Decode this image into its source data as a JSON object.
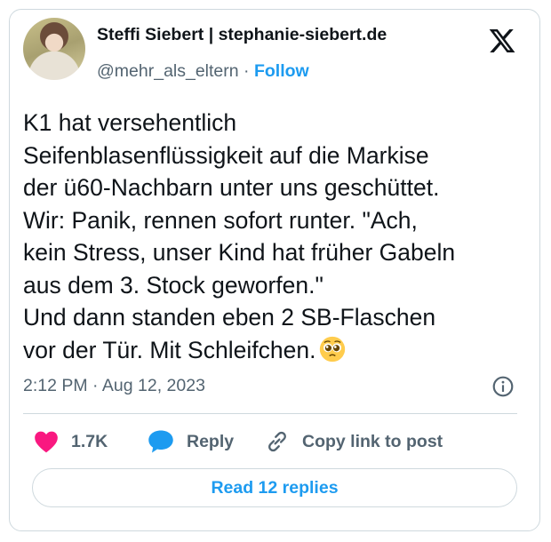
{
  "author": {
    "name": "Steffi Siebert | stephanie-siebert.de",
    "handle": "@mehr_als_eltern",
    "separator": "·",
    "follow_label": "Follow"
  },
  "tweet": {
    "text": "K1 hat versehentlich\nSeifenblasenflüssigkeit auf die Markise\nder ü60-Nachbarn unter uns geschüttet.\nWir: Panik, rennen sofort runter. \"Ach,\nkein Stress, unser Kind hat früher Gabeln\naus dem 3. Stock geworfen.\"\nUnd dann standen eben 2 SB-Flaschen\nvor der Tür. Mit Schleifchen.",
    "emoji": "pleading-face-emoji",
    "time": "2:12 PM",
    "date_separator": "·",
    "date": "Aug 12, 2023"
  },
  "actions": {
    "like_count": "1.7K",
    "reply_label": "Reply",
    "copy_label": "Copy link to post"
  },
  "read_replies_label": "Read 12 replies",
  "icons": {
    "logo": "x-logo-icon",
    "info": "info-icon",
    "like": "heart-icon",
    "reply": "speech-bubble-icon",
    "copy": "link-icon"
  },
  "colors": {
    "accent": "#1d9bf0",
    "like": "#f91880",
    "text": "#0f1419",
    "muted": "#536471",
    "border": "#cfd9de"
  }
}
